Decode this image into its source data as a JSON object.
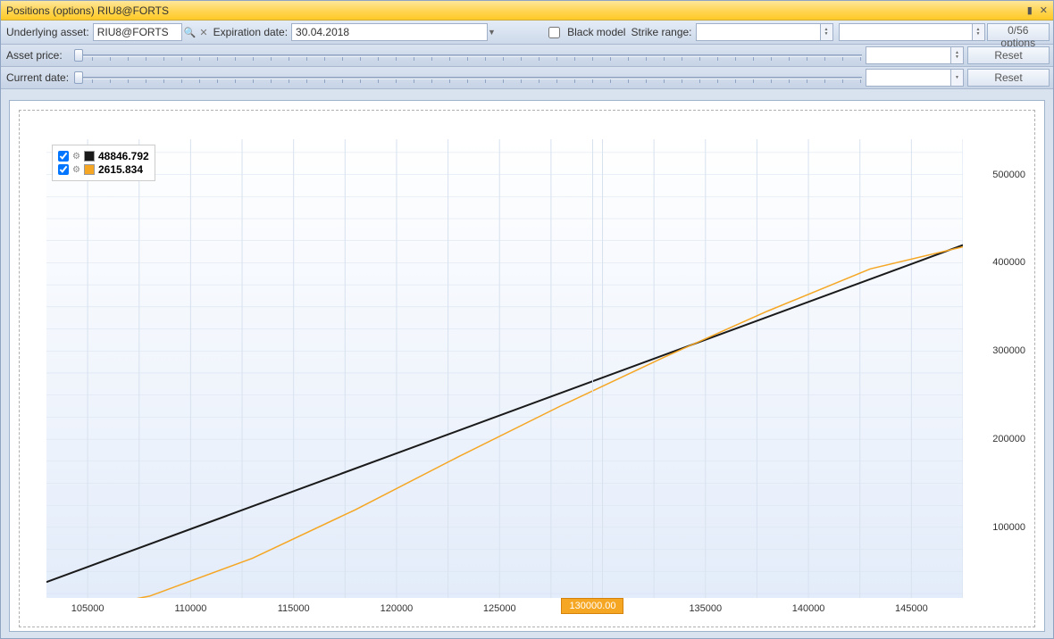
{
  "window": {
    "title": "Positions (options)   RIU8@FORTS"
  },
  "toolbar": {
    "underlying_label": "Underlying asset:",
    "underlying_value": "RIU8@FORTS",
    "expiration_label": "Expiration date:",
    "expiration_value": "30.04.2018",
    "black_model_label": "Black model",
    "strike_range_label": "Strike range:",
    "strike_range_value": "",
    "extra_combo_value": "",
    "options_counter": "0/56 options",
    "asset_price_label": "Asset price:",
    "asset_price_spin_value": "",
    "asset_price_reset": "Reset",
    "current_date_label": "Current date:",
    "current_date_combo_value": "",
    "current_date_reset": "Reset"
  },
  "legend": {
    "series": [
      {
        "color": "#1a1a1a",
        "value": "48846.792"
      },
      {
        "color": "#f5a623",
        "value": "2615.834"
      }
    ]
  },
  "cursor": {
    "x_value": "130000.00",
    "x_frac": 0.596
  },
  "chart_data": {
    "type": "line",
    "xlabel": "",
    "ylabel": "",
    "xlim": [
      103000,
      147500
    ],
    "ylim": [
      20000,
      540000
    ],
    "x_ticks": [
      105000,
      110000,
      115000,
      120000,
      125000,
      130000,
      135000,
      140000,
      145000
    ],
    "y_ticks": [
      100000,
      200000,
      300000,
      400000,
      500000
    ],
    "series": [
      {
        "name": "black",
        "color": "#1a1a1a",
        "points": [
          [
            103000,
            38000
          ],
          [
            147500,
            420000
          ]
        ]
      },
      {
        "name": "orange",
        "color": "#f5a623",
        "points": [
          [
            103000,
            0
          ],
          [
            108000,
            22000
          ],
          [
            113000,
            65000
          ],
          [
            118000,
            120000
          ],
          [
            123000,
            180000
          ],
          [
            128000,
            238000
          ],
          [
            133000,
            293000
          ],
          [
            138000,
            345000
          ],
          [
            143000,
            393000
          ],
          [
            147500,
            418000
          ]
        ]
      }
    ]
  }
}
